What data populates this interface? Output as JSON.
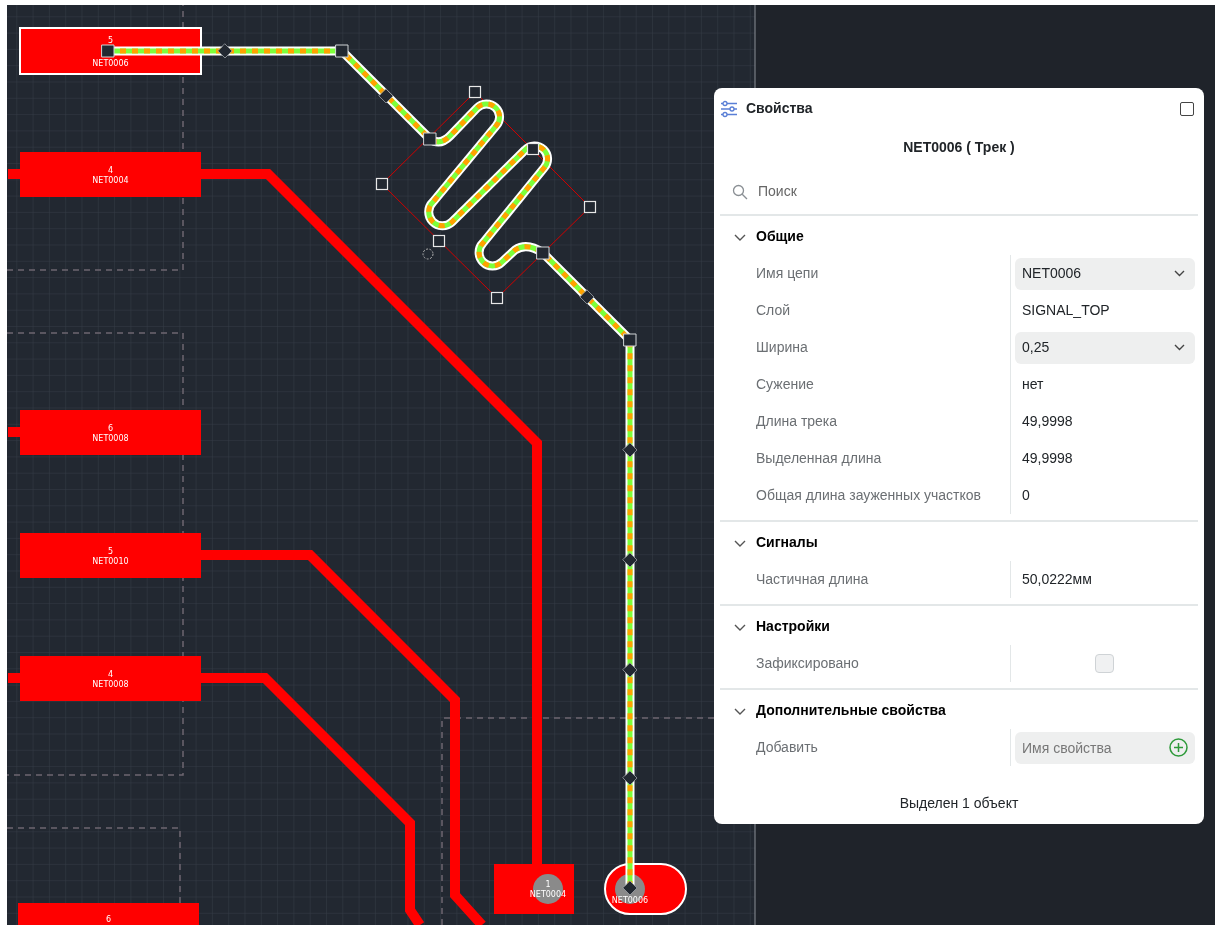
{
  "canvas": {
    "pads": [
      {
        "number": "5",
        "net": "NET0006",
        "kind": "rect",
        "hole": false,
        "selected": true
      },
      {
        "number": "4",
        "net": "NET0004",
        "kind": "rect",
        "hole": false,
        "selected": false
      },
      {
        "number": "6",
        "net": "NET0008",
        "kind": "rect",
        "hole": false,
        "selected": false
      },
      {
        "number": "5",
        "net": "NET0010",
        "kind": "rect",
        "hole": false,
        "selected": false
      },
      {
        "number": "4",
        "net": "NET0008",
        "kind": "rect",
        "hole": false,
        "selected": false
      },
      {
        "number": "6",
        "kind": "rect",
        "hole": false,
        "selected": false
      },
      {
        "number": "1",
        "net": "NET0004",
        "kind": "rect",
        "hole": true,
        "selected": false
      },
      {
        "net": "NET0006",
        "kind": "oval",
        "hole": true,
        "selected": true
      }
    ]
  },
  "panel": {
    "title": "Свойства",
    "object_title": "NET0006 ( Трек )",
    "search": {
      "placeholder": "Поиск"
    },
    "sections": [
      {
        "title": "Общие",
        "expanded": true,
        "rows": [
          {
            "label": "Имя цепи",
            "kind": "select",
            "value": "NET0006"
          },
          {
            "label": "Слой",
            "kind": "text",
            "value": "SIGNAL_TOP"
          },
          {
            "label": "Ширина",
            "kind": "select",
            "value": "0,25"
          },
          {
            "label": "Сужение",
            "kind": "text",
            "value": "нет"
          },
          {
            "label": "Длина трека",
            "kind": "text",
            "value": "49,9998"
          },
          {
            "label": "Выделенная длина",
            "kind": "text",
            "value": "49,9998"
          },
          {
            "label": "Общая длина зауженных участков",
            "kind": "text",
            "value": "0"
          }
        ]
      },
      {
        "title": "Сигналы",
        "expanded": true,
        "rows": [
          {
            "label": "Частичная длина",
            "kind": "text",
            "value": "50,0222мм"
          }
        ]
      },
      {
        "title": "Настройки",
        "expanded": true,
        "rows": [
          {
            "label": "Зафиксировано",
            "kind": "checkbox",
            "checked": false
          }
        ]
      },
      {
        "title": "Дополнительные свойства",
        "expanded": true,
        "rows": [
          {
            "label": "Добавить",
            "kind": "input",
            "placeholder": "Имя свойства"
          }
        ]
      }
    ],
    "status": "Выделен 1 объект"
  }
}
